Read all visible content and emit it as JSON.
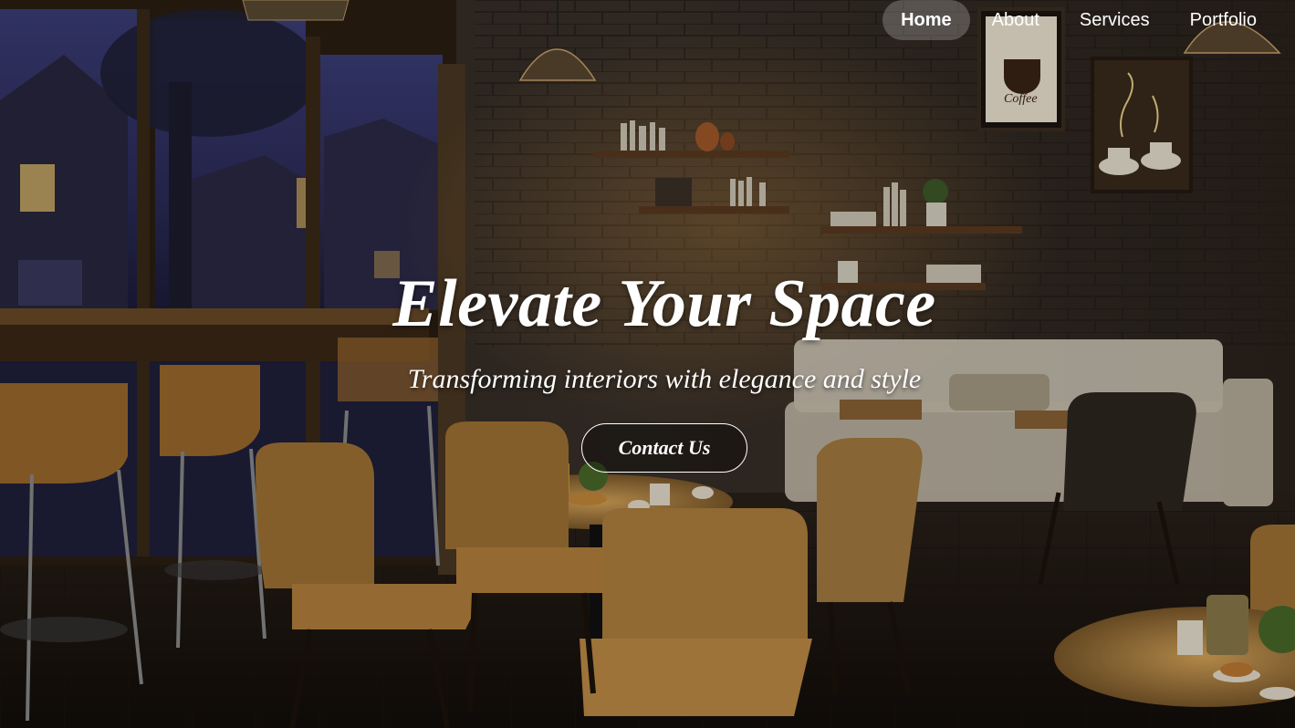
{
  "nav": {
    "items": [
      {
        "label": "Home",
        "active": true
      },
      {
        "label": "About",
        "active": false
      },
      {
        "label": "Services",
        "active": false
      },
      {
        "label": "Portfolio",
        "active": false
      }
    ]
  },
  "hero": {
    "title": "Elevate Your Space",
    "subtitle": "Transforming interiors with elegance and style",
    "cta_label": "Contact Us",
    "background": "dim cafe interior at night with rainy windows, wooden chairs and round tables, wall shelves and coffee posters"
  },
  "colors": {
    "text": "#ffffff",
    "nav_active_bg": "rgba(255,255,255,0.22)",
    "wood_warm": "#a7732e",
    "night_window": "#2c2d5a"
  }
}
